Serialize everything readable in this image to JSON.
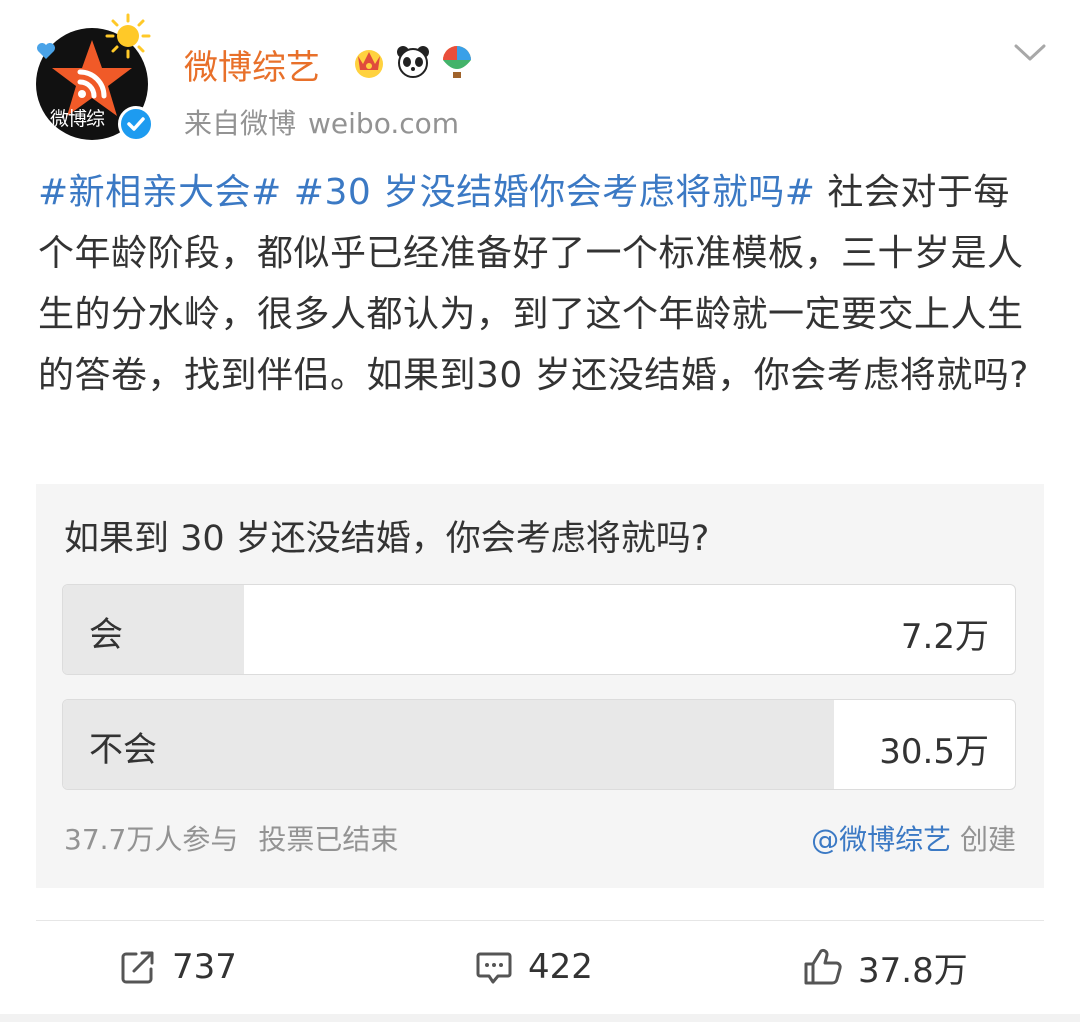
{
  "header": {
    "username": "微博综艺",
    "avatar_text": "微博综",
    "source_prefix": "来自微博",
    "source_domain": "weibo.com"
  },
  "post": {
    "hashtag_1": "#新相亲大会#",
    "hashtag_2": "#30 岁没结婚你会考虑将就吗#",
    "body": "社会对于每个年龄阶段，都似乎已经准备好了一个标准模板，三十岁是人生的分水岭，很多人都认为，到了这个年龄就一定要交上人生的答卷，找到伴侣。如果到30 岁还没结婚，你会考虑将就吗?"
  },
  "poll": {
    "question": "如果到 30 岁还没结婚，你会考虑将就吗?",
    "options": [
      {
        "label": "会",
        "count": "7.2万",
        "fraction": 0.19
      },
      {
        "label": "不会",
        "count": "30.5万",
        "fraction": 0.81
      }
    ],
    "participants": "37.7万人参与",
    "status": "投票已结束",
    "creator": "@微博综艺",
    "created_suffix": "创建"
  },
  "actions": {
    "repost_count": "737",
    "comment_count": "422",
    "like_count": "37.8万"
  },
  "colors": {
    "username": "#e8702a",
    "link": "#3b79c4",
    "muted": "#939393",
    "verified": "#1d9bf0"
  },
  "icons": [
    "sun-icon",
    "heart-icon",
    "star-logo-icon",
    "verified-icon",
    "crown-badge-icon",
    "panda-badge-icon",
    "balloon-badge-icon",
    "chevron-down-icon",
    "repost-icon",
    "comment-icon",
    "like-icon"
  ]
}
